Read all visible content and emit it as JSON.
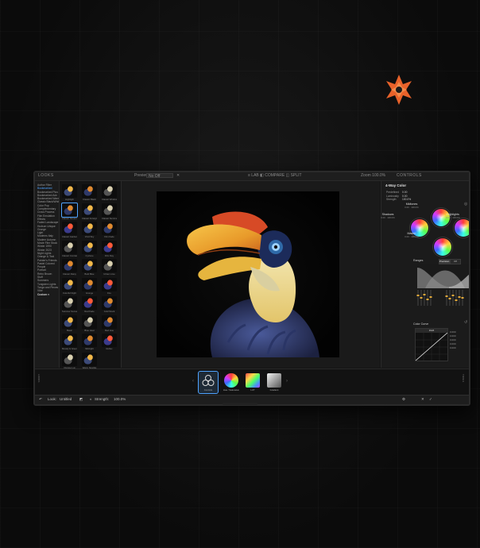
{
  "colors": {
    "accent": "#4fa3ff",
    "brand_logo": "#e8622a",
    "panel_bg": "#1b1b1b"
  },
  "topbar": {
    "looks_title": "LOOKS",
    "controls_title": "CONTROLS",
    "preview_label": "Preview",
    "preview_value": "No Off",
    "close_icon": "close-icon",
    "tools_text": "≡ LAB   ◧ COMPARE   ◫ SPLIT",
    "zoom_text": "Zoom 100.0%"
  },
  "categories": [
    {
      "label": "Author Filter",
      "type": "item"
    },
    {
      "label": "Bookmarked",
      "type": "active"
    },
    {
      "label": "Bookmarked Plus",
      "type": "item"
    },
    {
      "label": "Bookmarked Adv",
      "type": "item"
    },
    {
      "label": "Bookmarked Warm",
      "type": "item"
    },
    {
      "label": "Classic Black/White",
      "type": "item"
    },
    {
      "label": "Color Pop",
      "type": "item"
    },
    {
      "label": "Complementary",
      "type": "item"
    },
    {
      "label": "Cross Process",
      "type": "item"
    },
    {
      "label": "Film Emulation",
      "type": "item"
    },
    {
      "label": "Effects",
      "type": "item"
    },
    {
      "label": "Faded Landscape",
      "type": "item"
    },
    {
      "label": "Hudson Unique",
      "type": "item"
    },
    {
      "label": "Grunge",
      "type": "item"
    },
    {
      "label": "Light",
      "type": "item"
    },
    {
      "label": "Moderns Italy",
      "type": "item"
    },
    {
      "label": "Modern Autumn",
      "type": "item"
    },
    {
      "label": "Movie Film Stock",
      "type": "item"
    },
    {
      "label": "Winter 1990",
      "type": "item"
    },
    {
      "label": "Winter 2023",
      "type": "item"
    },
    {
      "label": "Night Lights",
      "type": "item"
    },
    {
      "label": "Orange & Teal",
      "type": "item"
    },
    {
      "label": "Painter's Friends",
      "type": "item"
    },
    {
      "label": "Pastel Colored",
      "type": "item"
    },
    {
      "label": "People",
      "type": "item"
    },
    {
      "label": "Portrait",
      "type": "item"
    },
    {
      "label": "Retro Brown",
      "type": "item"
    },
    {
      "label": "Stuff",
      "type": "item"
    },
    {
      "label": "Summers",
      "type": "item"
    },
    {
      "label": "Tungsten Lights",
      "type": "item"
    },
    {
      "label": "Tonga and Pieces",
      "type": "item"
    },
    {
      "label": "Vibe",
      "type": "item"
    },
    {
      "label": "Custom ▾",
      "type": "section"
    }
  ],
  "thumbnails": [
    {
      "label": "Highlight",
      "v": "0"
    },
    {
      "label": "Classic Black",
      "v": "1"
    },
    {
      "label": "Classic Windows",
      "v": "2"
    },
    {
      "label": "Classic Streaming",
      "v": "1"
    },
    {
      "label": "Classic Foreign",
      "v": "0"
    },
    {
      "label": "Classic Summer",
      "v": "2"
    },
    {
      "label": "Classic Garden",
      "v": "3"
    },
    {
      "label": "Vivid Sky",
      "v": "0"
    },
    {
      "label": "Film Fade",
      "v": "1"
    },
    {
      "label": "Classic Contrast",
      "v": "2"
    },
    {
      "label": "Cyclone",
      "v": "0"
    },
    {
      "label": "Film Day",
      "v": "3"
    },
    {
      "label": "Classic Rainy",
      "v": "1"
    },
    {
      "label": "Bold Blue",
      "v": "0"
    },
    {
      "label": "Urban Lime",
      "v": "2"
    },
    {
      "label": "Colorful Night",
      "v": "0"
    },
    {
      "label": "Grunge",
      "v": "1"
    },
    {
      "label": "Fire",
      "v": "3"
    },
    {
      "label": "Summer Sunset",
      "v": "2"
    },
    {
      "label": "Red Fade",
      "v": "3"
    },
    {
      "label": "Cold Stock",
      "v": "1"
    },
    {
      "label": "Basic",
      "v": "0"
    },
    {
      "label": "Blue Heat",
      "v": "2"
    },
    {
      "label": "Red Hue",
      "v": "1"
    },
    {
      "label": "Moody & Green",
      "v": "0"
    },
    {
      "label": "Midnight",
      "v": "1"
    },
    {
      "label": "Reflex",
      "v": "3"
    },
    {
      "label": "Orange Lux",
      "v": "2"
    },
    {
      "label": "Warm Sparkle",
      "v": "0"
    }
  ],
  "panel": {
    "section_title": "4-Way Color",
    "rows": [
      {
        "label": "Predefined",
        "value": "0.00"
      },
      {
        "label": "Luminosity",
        "value": "0.00"
      },
      {
        "label": "Strength",
        "value": "100.0%"
      }
    ],
    "wheels": [
      {
        "name": "Midtones",
        "sub": "0.00 · 100.0%"
      },
      {
        "name": "Shadows",
        "sub": "0.00 · 100.0%"
      },
      {
        "name": "Highlights",
        "sub": "0.00 · 100.0%"
      },
      {
        "name": "Master",
        "sub": "0.00 · 100.0%"
      }
    ],
    "ranges_label": "Ranges",
    "ranges_buttons": [
      "Precision",
      "Off"
    ],
    "curve_label": "Color Curve",
    "curve_head": "RGB",
    "curve_values": [
      "0.000",
      "0.000",
      "0.000",
      "0.000",
      "0.000"
    ]
  },
  "tools": [
    {
      "label": "Controls",
      "selected": true
    },
    {
      "label": "Hue / Saturation",
      "selected": false
    },
    {
      "label": "LUT",
      "selected": false
    },
    {
      "label": "Gradient",
      "selected": false
    }
  ],
  "side_tabs": {
    "left": "LOOKS",
    "right": "TOOLS"
  },
  "statusbar": {
    "look_label": "Look:",
    "look_name": "Untitled",
    "strength_label": "Strength:",
    "strength_value": "100.0%"
  }
}
